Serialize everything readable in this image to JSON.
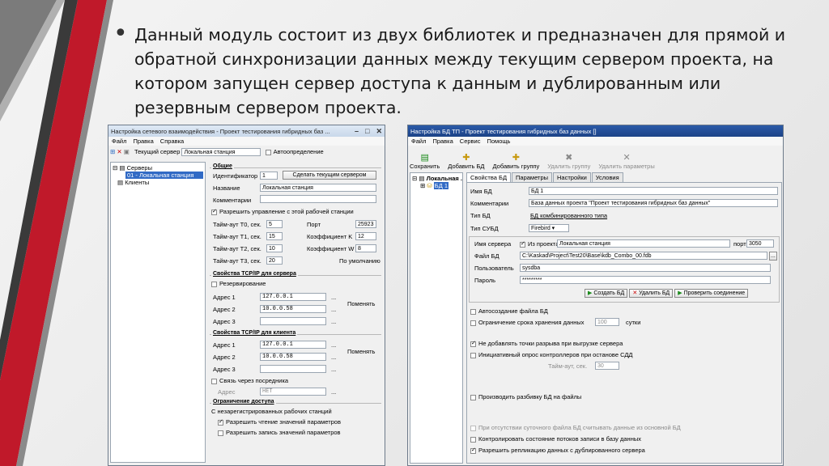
{
  "slide": {
    "bullet": "•",
    "text": "Данный модуль состоит из двух библиотек и предназначен для прямой и обратной синхронизации данных между текущим сервером проекта, на котором запущен сервер доступа к данным и дублированным или резервным сервером проекта."
  },
  "colors": {
    "accent_red": "#c0192a",
    "accent_dark": "#3a3a3a",
    "accent_gray": "#8a8a8a"
  },
  "left": {
    "title": "Настройка сетевого взаимодействия - Проект тестирования гибридных баз ...",
    "menu": [
      "Файл",
      "Правка",
      "Справка"
    ],
    "toolbar": {
      "server_label": "Текущий сервер",
      "server_value": "Локальная станция",
      "auto": "Автоопределение"
    },
    "tree": {
      "servers": "Серверы",
      "selected": "01 - Локальная станция",
      "clients": "Клиенты"
    },
    "general": {
      "title": "Общие",
      "id_label": "Идентификатор",
      "id_value": "1",
      "make_current": "Сделать текущим сервером",
      "name_label": "Название",
      "name_value": "Локальная станция",
      "comment_label": "Комментарии",
      "allow_control": "Разрешить управление с этой рабочей станции",
      "t0": "Тайм-аут T0, сек.",
      "t0v": "5",
      "t1": "Тайм-аут T1, сек.",
      "t1v": "15",
      "t2": "Тайм-аут T2, сек.",
      "t2v": "10",
      "t3": "Тайм-аут T3, сек.",
      "t3v": "20",
      "port": "Порт",
      "portv": "25923",
      "k": "Коэффициент K",
      "kv": "12",
      "w": "Коэффициент W",
      "wv": "8",
      "default": "По умолчанию"
    },
    "tcp_server": {
      "title": "Свойства TCP/IP для сервера",
      "reserve": "Резервирование",
      "a1": "Адрес 1",
      "a1v": "127.0.0.1",
      "a2": "Адрес 2",
      "a2v": "10.0.0.58",
      "a3": "Адрес 3",
      "change": "Поменять",
      "dots": "..."
    },
    "tcp_client": {
      "title": "Свойства TCP/IP для клиента",
      "a1": "Адрес 1",
      "a1v": "127.0.0.1",
      "a2": "Адрес 2",
      "a2v": "10.0.0.58",
      "a3": "Адрес 3",
      "change": "Поменять",
      "via": "Связь через посредника",
      "addr": "Адрес",
      "addrv": "НЕТ",
      "dots": "..."
    },
    "access": {
      "title": "Ограничение доступа",
      "unreg": "С незарегистрированных рабочих станций",
      "read": "Разрешить чтение значений параметров",
      "write": "Разрешить запись значений параметров"
    }
  },
  "right": {
    "title": "Настройка БД ТП - Проект тестирования гибридных баз данных []",
    "menu": [
      "Файл",
      "Правка",
      "Сервис",
      "Помощь"
    ],
    "toolbar": [
      "Сохранить",
      "Добавить БД",
      "Добавить группу",
      "Удалить группу",
      "Удалить параметры"
    ],
    "tree": {
      "root": "Локальная ...",
      "db": "БД 1"
    },
    "tabs": [
      "Свойства БД",
      "Параметры",
      "Настройки",
      "Условия"
    ],
    "props": {
      "name_l": "Имя БД",
      "name_v": "БД 1",
      "comm_l": "Комментарии",
      "comm_v": "База данных проекта \"Проект тестирования гибридных баз данных\"",
      "type_l": "Тип БД",
      "type_v": "БД комбинированного типа",
      "dbms_l": "Тип СУБД",
      "dbms_v": "Firebird"
    },
    "conn": {
      "server_l": "Имя сервера",
      "from_proj": "Из проекта",
      "server_v": "Локальная станция",
      "port_l": "порт",
      "port_v": "3050",
      "file_l": "Файл БД",
      "file_v": "C:\\Kaskad\\Project\\Test20\\Base\\kdb_Combo_00.fdb",
      "user_l": "Пользователь",
      "user_v": "sysdba",
      "pass_l": "Пароль",
      "pass_v": "*********",
      "create": "Создать БД",
      "delete": "Удалить БД",
      "check": "Проверить соединение"
    },
    "opts": {
      "autocreate": "Автосоздание файла БД",
      "limit": "Ограничение срока хранения данных",
      "limit_v": "100",
      "days": "сутки",
      "nobreak": "Не добавлять точки разрыва при выгрузке сервера",
      "poll": "Инициативный опрос контроллеров при останове СДД",
      "timeout": "Тайм-аут, сек.",
      "timeout_v": "30",
      "split": "Производить разбивку БД на файлы",
      "nodaily": "При отсутствии суточного файла БД считывать данные из основной БД",
      "control": "Контролировать состояние потоков записи в базу данных",
      "replic": "Разрешить репликацию данных с дублированного сервера"
    }
  }
}
